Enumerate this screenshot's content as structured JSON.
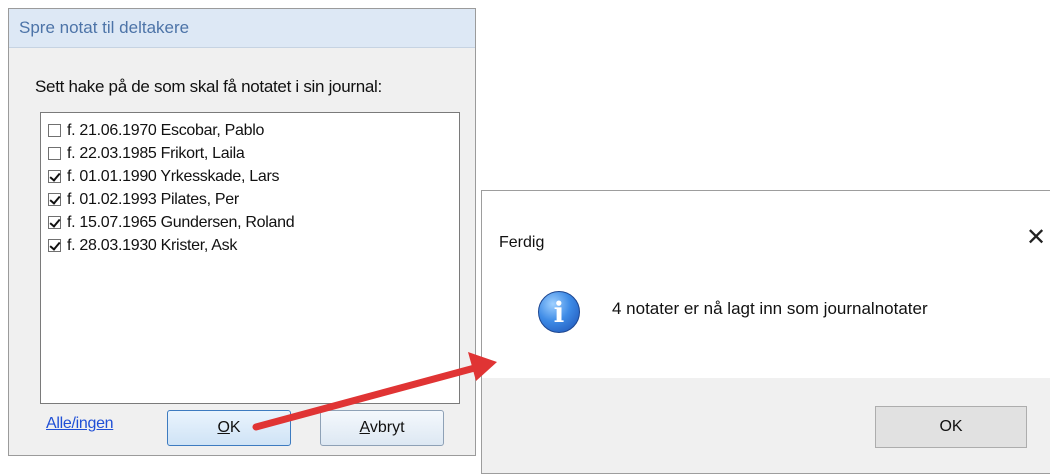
{
  "left_dialog": {
    "title": "Spre notat til deltakere",
    "instruction": "Sett hake på de som skal få notatet i sin journal:",
    "participants": [
      {
        "label": "f. 21.06.1970 Escobar, Pablo",
        "checked": false
      },
      {
        "label": "f. 22.03.1985 Frikort, Laila",
        "checked": false
      },
      {
        "label": "f. 01.01.1990 Yrkesskade, Lars",
        "checked": true
      },
      {
        "label": "f. 01.02.1993 Pilates, Per",
        "checked": true
      },
      {
        "label": "f. 15.07.1965 Gundersen, Roland",
        "checked": true
      },
      {
        "label": "f. 28.03.1930 Krister, Ask",
        "checked": true
      }
    ],
    "select_all_link": "Alle/ingen",
    "ok_button": {
      "label": "OK",
      "mnemonic": "O"
    },
    "cancel_button": {
      "label": "Avbryt",
      "mnemonic": "A"
    }
  },
  "right_dialog": {
    "title": "Ferdig",
    "close_glyph": "✕",
    "icon": "info-icon",
    "icon_glyph": "i",
    "message": "4 notater er nå lagt inn som journalnotater",
    "ok_button": "OK"
  },
  "colors": {
    "title_text": "#4d74a8",
    "link": "#1f4fd6",
    "arrow": "#e03434",
    "dialog_bg": "#f0f0f0"
  }
}
